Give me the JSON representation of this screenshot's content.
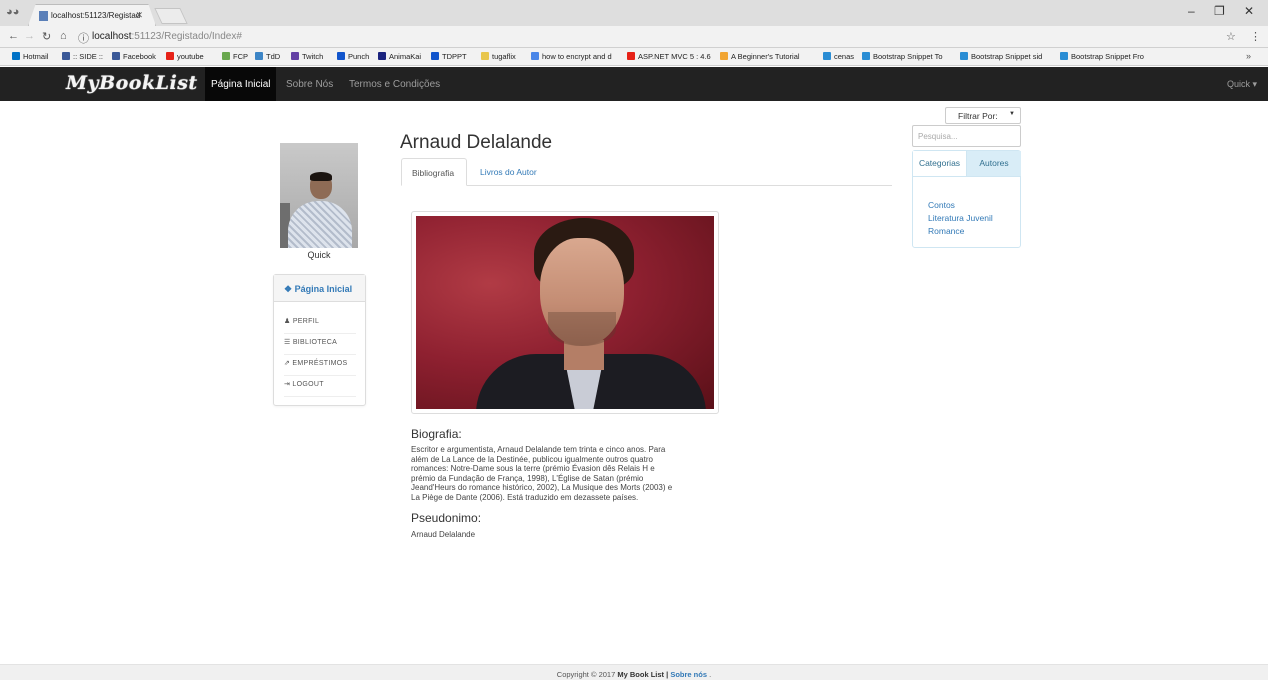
{
  "browser": {
    "tab_title": "localhost:51123/Registad",
    "url_host": "localhost",
    "url_path": ":51123/Registado/Index#",
    "bookmarks": [
      "Hotmail",
      ":: SIDE ::",
      "Facebook",
      "youtube",
      "FCP",
      "TdD",
      "Twitch",
      "Punch",
      "AnimaKai",
      "TDPPT",
      "tugaflix",
      "how to encrypt and d",
      "ASP.NET MVC 5 : 4.6",
      "A Beginner's Tutorial",
      "cenas",
      "Bootstrap Snippet To",
      "Bootstrap Snippet sid",
      "Bootstrap Snippet Fro"
    ],
    "bookmark_colors": [
      "#0072c6",
      "#3b5998",
      "#3b5998",
      "#e62117",
      "#6aa84f",
      "#3d85c6",
      "#6441a5",
      "#1155cc",
      "#1a237e",
      "#1155cc",
      "#e8c64d",
      "#4a86e8",
      "#e62117",
      "#f1a533",
      "#2a8dd4",
      "#2a8dd4",
      "#2a8dd4",
      "#2a8dd4"
    ]
  },
  "navbar": {
    "brand": "MyBookList",
    "links": [
      "Página Inicial",
      "Sobre Nós",
      "Termos e Condições"
    ],
    "user_menu": "Quick ▾"
  },
  "profile": {
    "username": "Quick",
    "menu_title": "Página Inicial",
    "menu_items": [
      "PERFIL",
      "BIBLIOTECA",
      "EMPRÉSTIMOS",
      "LOGOUT"
    ]
  },
  "author": {
    "name": "Arnaud Delalande",
    "tabs": [
      "Bibliografia",
      "Livros do Autor"
    ],
    "bio_heading": "Biografia:",
    "bio_lines": [
      "Escritor e argumentista, Arnaud Delalande tem trinta e cinco anos. Para",
      "além de La Lance de la Destinée, publicou igualmente outros quatro",
      "romances: Notre-Dame sous la terre (prémio Évasion dês Relais H e",
      "prémio da Fundação de França, 1998), L'Église de Satan (prémio",
      "Jeand'Heurs do romance histórico, 2002), La Musique des Morts (2003) e",
      "La Piège de Dante (2006). Está traduzido em dezassete países."
    ],
    "pseudonym_heading": "Pseudonimo:",
    "pseudonym": "Arnaud Delalande"
  },
  "filter": {
    "select_label": "Filtrar Por:",
    "search_placeholder": "Pesquisa...",
    "tabs": [
      "Categorias",
      "Autores"
    ],
    "categories": [
      "Contos",
      "Literatura Juvenil",
      "Romance"
    ]
  },
  "footer": {
    "prefix": "Copyright © 2017",
    "brand": "My Book List",
    "separator": "|",
    "link": "Sobre nós",
    "suffix": "."
  }
}
